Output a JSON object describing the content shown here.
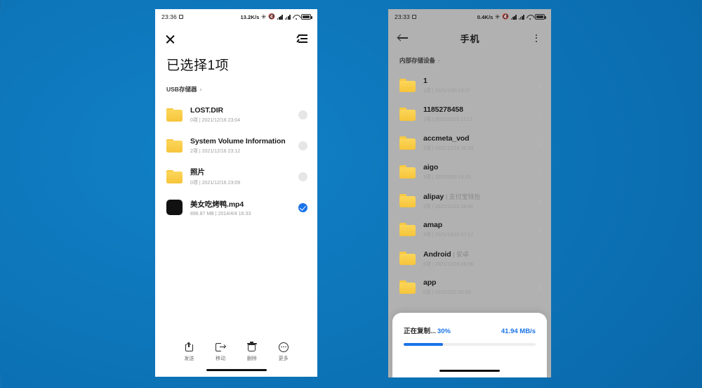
{
  "background": {
    "color": "#0d74b8",
    "description": "blue-wallpaper"
  },
  "left_phone": {
    "status_bar": {
      "time": "23:36",
      "net_speed": "13.2K/s",
      "icons": [
        "alarm-icon",
        "bluetooth-icon",
        "mute-icon",
        "signal-icon",
        "signal-icon",
        "wifi-icon",
        "battery-icon"
      ]
    },
    "appbar": {
      "close_label": "✕",
      "sort_label": "排序"
    },
    "title": "已选择1项",
    "breadcrumb": {
      "label": "USB存储器",
      "chevron": "›"
    },
    "files": [
      {
        "name": "LOST.DIR",
        "alias": "",
        "sub": "0项 | 2021/12/16 23:04",
        "type": "folder",
        "selected": false
      },
      {
        "name": "System Volume Information",
        "alias": "",
        "sub": "2项 | 2021/12/16 23:12",
        "type": "folder",
        "selected": false
      },
      {
        "name": "照片",
        "alias": "",
        "sub": "0项 | 2021/12/16 23:09",
        "type": "folder",
        "selected": false
      },
      {
        "name": "美女吃烤鸭.mp4",
        "alias": "",
        "sub": "896.87 MB | 2014/4/4 16:33",
        "type": "video",
        "selected": true
      }
    ],
    "toolbar": [
      {
        "label": "发送",
        "icon": "share-icon"
      },
      {
        "label": "移动",
        "icon": "move-icon"
      },
      {
        "label": "删除",
        "icon": "trash-icon"
      },
      {
        "label": "更多",
        "icon": "more-icon"
      }
    ]
  },
  "right_phone": {
    "status_bar": {
      "time": "23:33",
      "net_speed": "0.4K/s",
      "icons": [
        "alarm-icon",
        "bluetooth-icon",
        "mute-icon",
        "signal-icon",
        "signal-icon",
        "wifi-icon",
        "battery-icon"
      ]
    },
    "appbar": {
      "back_label": "返回",
      "title": "手机",
      "menu_label": "更多选项"
    },
    "breadcrumb": {
      "label": "内部存储设备",
      "chevron": "›"
    },
    "files": [
      {
        "name": "1",
        "alias": "",
        "sub": "1项 | 2021/1/30 19:37"
      },
      {
        "name": "1185278458",
        "alias": "",
        "sub": "1项 | 2021/10/20 11:17"
      },
      {
        "name": "accmeta_vod",
        "alias": "",
        "sub": "3项 | 2021/12/16 20:33"
      },
      {
        "name": "aigo",
        "alias": "",
        "sub": "3项 | 2021/5/10 18:10"
      },
      {
        "name": "alipay",
        "alias": "支付宝钱包",
        "sub": "2项 | 2021/11/23 18:44"
      },
      {
        "name": "amap",
        "alias": "",
        "sub": "4项 | 2021/12/16 07:17"
      },
      {
        "name": "Android",
        "alias": "安卓",
        "sub": "8项 | 2021/12/16 06:38"
      },
      {
        "name": "app",
        "alias": "",
        "sub": "0项 | 2021/7/22 20:19"
      }
    ],
    "copy_dialog": {
      "status_text": "正在复制...",
      "percent_label": "30%",
      "percent_value": 30,
      "speed": "41.94 MB/s",
      "accent_color": "#1a73e8"
    }
  }
}
